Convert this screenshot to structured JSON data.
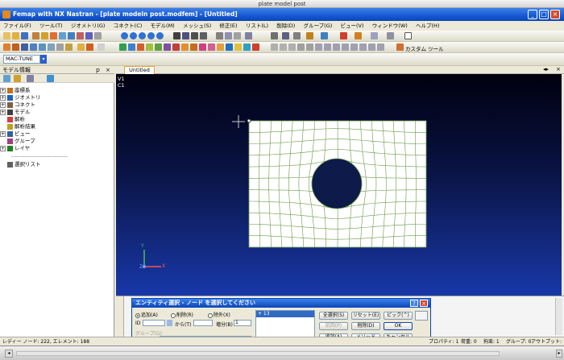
{
  "window": {
    "outer_title": "plate model post",
    "app_title": "Femap with NX Nastran - [plate modeln post.modfem] - [Untitled]"
  },
  "menu": [
    "ファイル(F)",
    "ツール(T)",
    "ジオメトリ(G)",
    "コネクト(C)",
    "モデル(M)",
    "メッシュ(S)",
    "修正(E)",
    "リスト(L)",
    "削除(D)",
    "グループ(G)",
    "ビュー(V)",
    "ウィンドウ(W)",
    "ヘルプ(H)"
  ],
  "toolbar": {
    "mac_tune": "MAC-TUNE",
    "custom_tools": "カスタム ツール"
  },
  "model_panel": {
    "title": "モデル情報",
    "pin": "ｐ",
    "close": "×",
    "items": [
      {
        "label": "座標系",
        "exp": "+",
        "color": "#c07020"
      },
      {
        "label": "ジオメトリ",
        "exp": "+",
        "color": "#2060c0"
      },
      {
        "label": "コネクト",
        "exp": "+",
        "color": "#806040"
      },
      {
        "label": "モデル",
        "exp": "+",
        "color": "#404040"
      },
      {
        "label": "解析",
        "exp": "",
        "color": "#d04040"
      },
      {
        "label": "解析結果",
        "exp": "",
        "color": "#c0a020"
      },
      {
        "label": "ビュー",
        "exp": "+",
        "color": "#3060a0"
      },
      {
        "label": "グループ",
        "exp": "",
        "color": "#a04080"
      },
      {
        "label": "レイヤ",
        "exp": "+",
        "color": "#208020"
      }
    ],
    "separator": "------------------------------",
    "selection_list": "選択リスト"
  },
  "graphics": {
    "tab_label": "Untitled",
    "view_label_1": "V1",
    "view_label_2": "C1",
    "axis_x": "X",
    "axis_y": "Y",
    "axis_z": "Z"
  },
  "dialog": {
    "title": "エンティティ選択 - ノード を選択してください",
    "radio_add": "追加(A)",
    "radio_delete": "削除(R)",
    "radio_exclude": "除外(X)",
    "id_label": "ID",
    "from_label": "から(T)",
    "step_label": "増分(B)",
    "step_value": "1",
    "group_label": "グループ(G)",
    "list_entry": "+ 13",
    "btn_select_all": "全選択(S)",
    "btn_reset": "リセット(E)",
    "btn_pick": "ピック(^)",
    "btn_prev": "前回(P)",
    "btn_delete": "削除(D)",
    "btn_ok": "OK",
    "btn_add": "追加(A)",
    "btn_method": "メソッド(^M)",
    "btn_cancel": "キャンセル"
  },
  "status": {
    "left": "レディー ノード: 222, エレメント: 188",
    "right_prop": "プロパティ: 1",
    "right_load": "荷重: 0",
    "right_constraint": "拘束: 1",
    "right_group": "グループ: 0",
    "right_output": "アウトプット: 0"
  },
  "colors": {
    "mesh_line": "#6a9a48",
    "plate_fill": "#ffffff",
    "hole_fill": "#0d1a4a",
    "title_blue": "#0a46b8"
  }
}
